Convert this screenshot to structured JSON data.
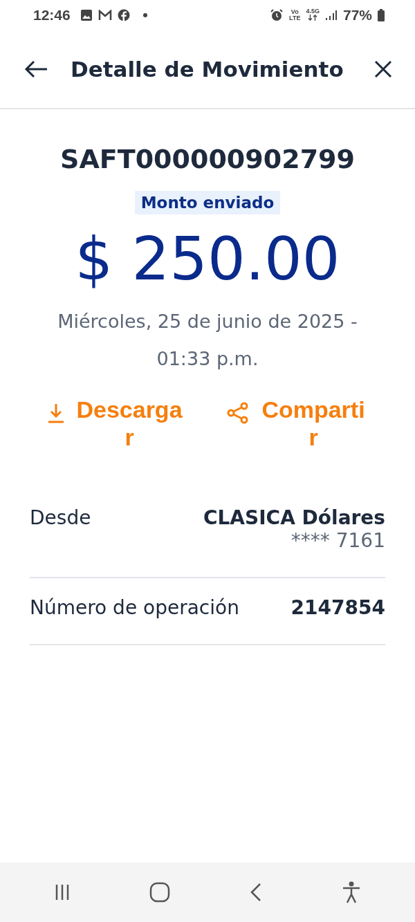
{
  "status_bar": {
    "time": "12:46",
    "network_top": "Vo",
    "network_bottom": "LTE",
    "data_type": "4.5G",
    "battery": "77%"
  },
  "header": {
    "title": "Detalle de Movimiento"
  },
  "reference": "SAFT000000902799",
  "amount_label": "Monto enviado",
  "amount": "$ 250.00",
  "date": "Miércoles, 25 de junio de 2025 - 01:33 p.m.",
  "actions": [
    {
      "kind": "download",
      "label": "Descargar"
    },
    {
      "kind": "share",
      "label": "Compartir"
    }
  ],
  "details": [
    {
      "label": "Desde",
      "value": "CLASICA Dólares",
      "subvalue": "**** 7161"
    },
    {
      "label": "Número de operación",
      "value": "2147854"
    }
  ]
}
